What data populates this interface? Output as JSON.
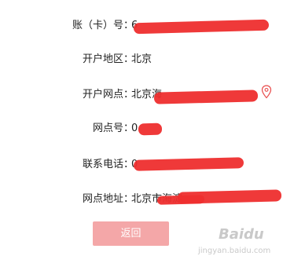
{
  "form": {
    "account": {
      "label": "账（卡）号",
      "colon": "：",
      "value": "6"
    },
    "region": {
      "label": "开户地区",
      "colon": "：",
      "value": "北京"
    },
    "branch": {
      "label": "开户网点",
      "colon": "：",
      "value": "北京海"
    },
    "branch_no": {
      "label": "网点号",
      "colon": "：",
      "value": "0"
    },
    "phone": {
      "label": "联系电话",
      "colon": "：",
      "value": "0"
    },
    "address": {
      "label": "网点地址",
      "colon": "：",
      "value": "北京市海淀"
    }
  },
  "actions": {
    "back_label": "返回"
  },
  "watermark": {
    "brand": "Baidu",
    "subtitle": "jingyan.baidu.com"
  },
  "colors": {
    "redaction": "#ee2e2e",
    "button_bg": "#f4a7a8",
    "pin": "#e84a4a"
  },
  "icons": {
    "location": "map-pin-icon"
  }
}
